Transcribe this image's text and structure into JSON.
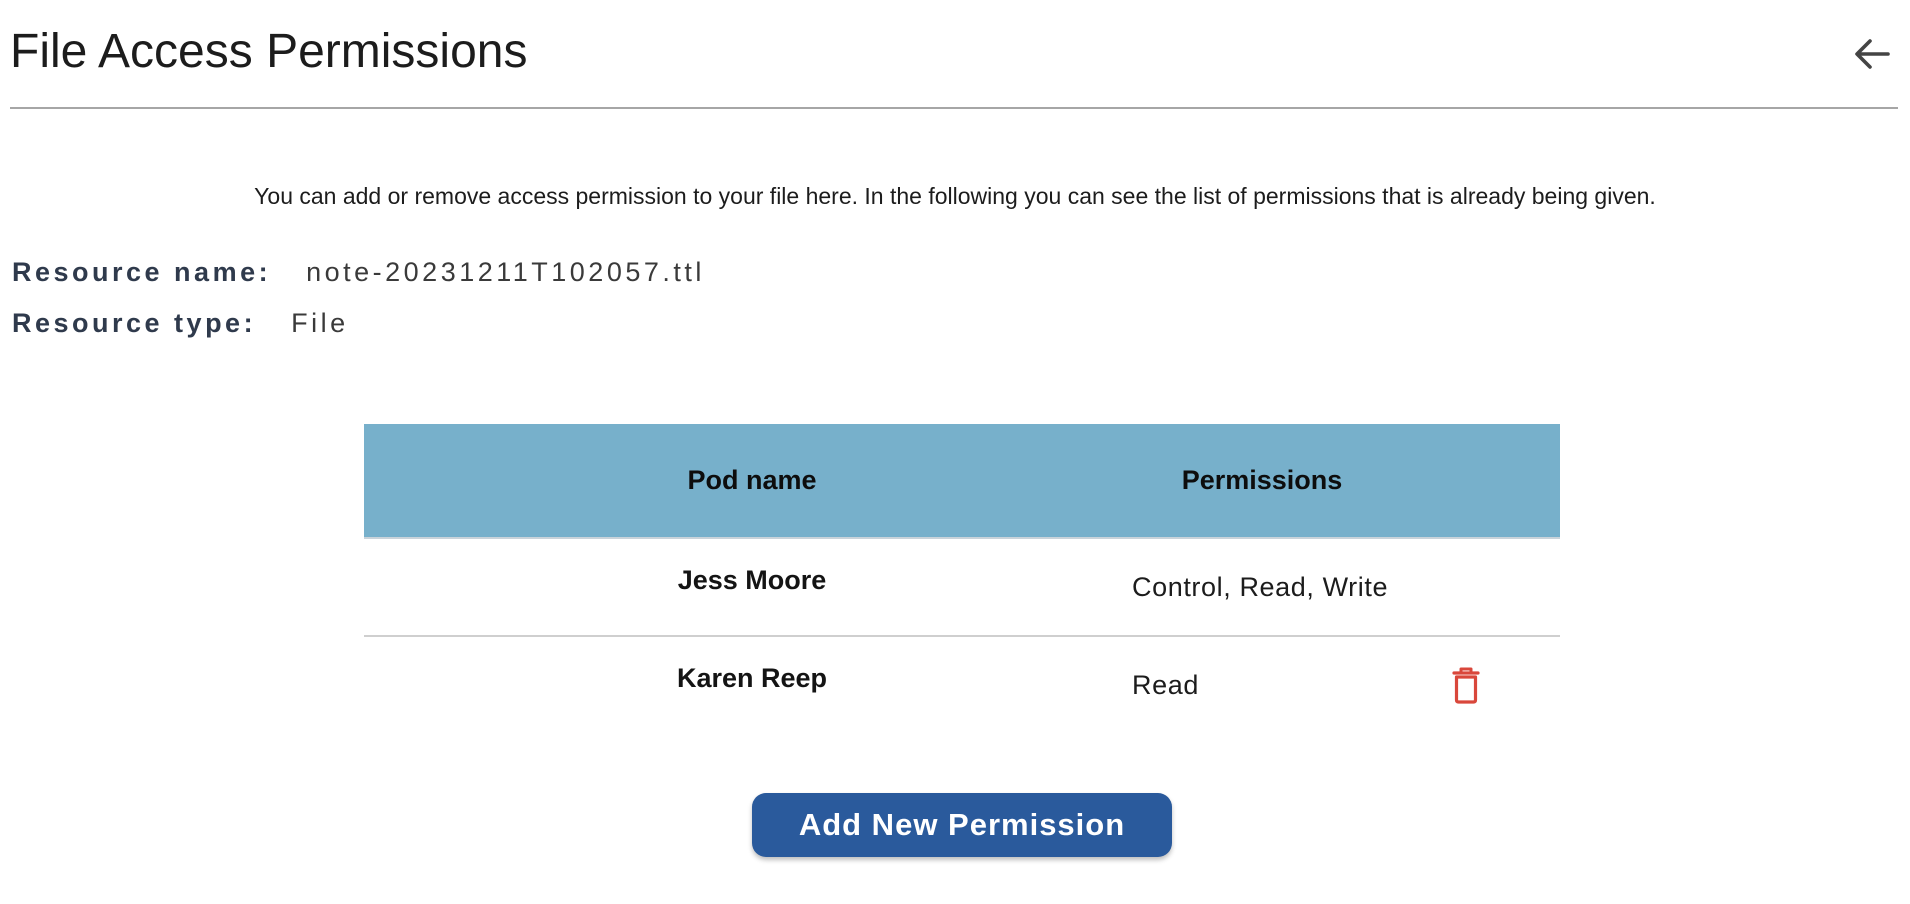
{
  "header": {
    "title": "File Access Permissions",
    "back_icon": "arrow-left-icon"
  },
  "intro_text": "You can add or remove access permission to your file here. In the following you can see the list of permissions that is already being given.",
  "resource": {
    "name_label": "Resource name:",
    "name_value": "note-20231211T102057.ttl",
    "type_label": "Resource type:",
    "type_value": "File"
  },
  "table": {
    "headers": {
      "pod_name": "Pod name",
      "permissions": "Permissions"
    },
    "rows": [
      {
        "pod_name": "Jess Moore",
        "permissions": "Control, Read, Write",
        "deletable": false
      },
      {
        "pod_name": "Karen Reep",
        "permissions": "Read",
        "deletable": true
      }
    ],
    "header_color": "#77b0cb",
    "delete_icon": "trash-icon",
    "delete_color": "#d9473b"
  },
  "actions": {
    "add_label": "Add New Permission",
    "add_color": "#2a5a9c"
  }
}
